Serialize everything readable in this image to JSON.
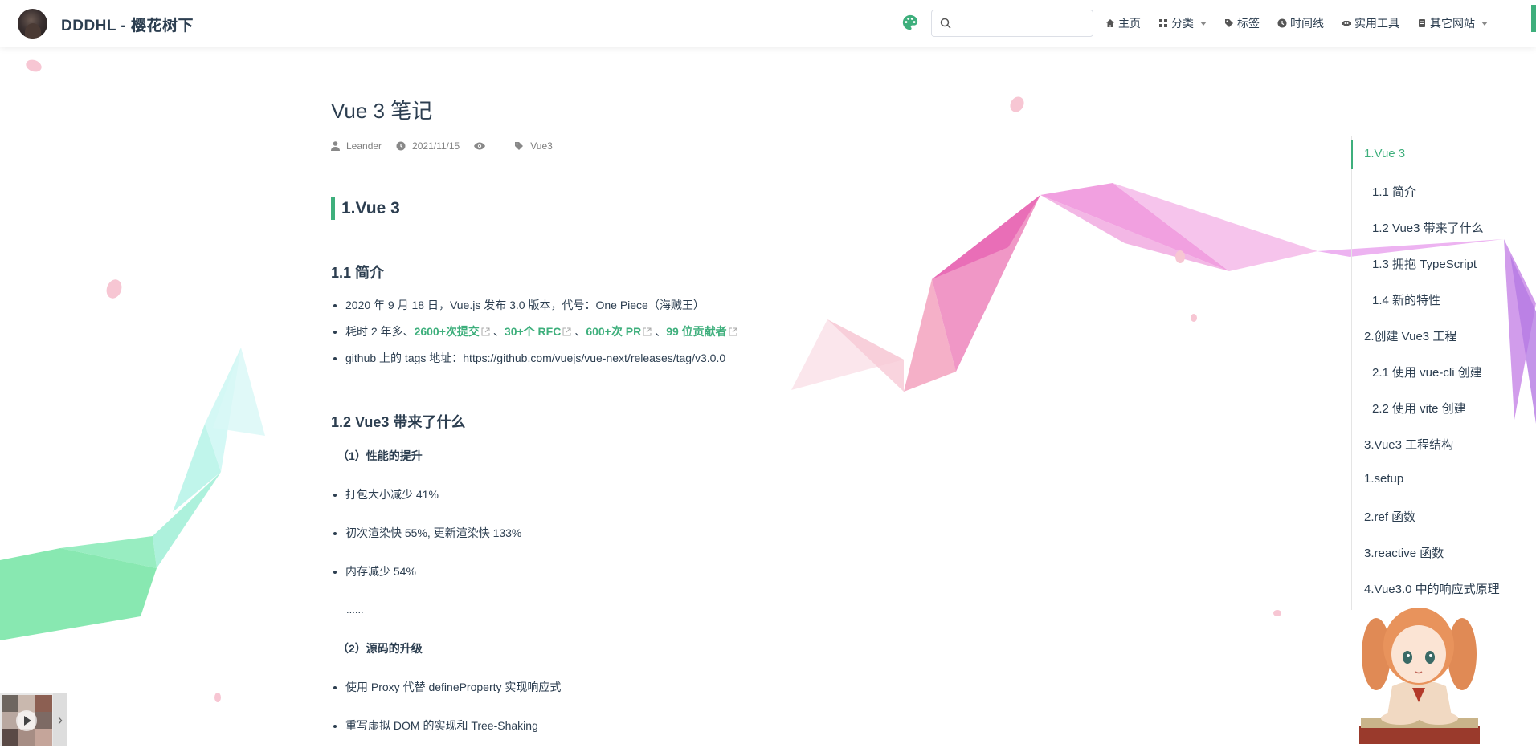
{
  "header": {
    "site_name": "DDDHL - 樱花树下",
    "search": {
      "placeholder": "",
      "value": ""
    },
    "nav": [
      {
        "label": "主页",
        "icon": "home-icon"
      },
      {
        "label": "分类",
        "icon": "grid-icon",
        "dropdown": true
      },
      {
        "label": "标签",
        "icon": "tag-icon"
      },
      {
        "label": "时间线",
        "icon": "clock-icon"
      },
      {
        "label": "实用工具",
        "icon": "robot-icon"
      },
      {
        "label": "其它网站",
        "icon": "book-icon",
        "dropdown": true
      }
    ]
  },
  "article": {
    "title": "Vue 3 笔记",
    "meta": {
      "author": "Leander",
      "date": "2021/11/15",
      "tag": "Vue3"
    },
    "h2": "1.Vue 3",
    "sec1": {
      "heading": "1.1 简介",
      "item1": "2020 年 9 月 18 日，Vue.js 发布 3.0 版本，代号：One Piece（海贼王）",
      "item2_prefix": "耗时 2 年多、",
      "links": [
        "2600+次提交",
        "30+个 RFC",
        "600+次 PR",
        "99 位贡献者"
      ],
      "sep": "、",
      "item3": "github 上的 tags 地址：https://github.com/vuejs/vue-next/releases/tag/v3.0.0"
    },
    "sec2": {
      "heading": "1.2 Vue3 带来了什么",
      "sub1": "（1）性能的提升",
      "perf": [
        "打包大小减少 41%",
        "初次渲染快 55%, 更新渲染快 133%",
        "内存减少 54%"
      ],
      "ellipsis": "......",
      "sub2": "（2）源码的升级",
      "source": [
        "使用 Proxy 代替 defineProperty 实现响应式",
        "重写虚拟 DOM 的实现和 Tree-Shaking"
      ]
    }
  },
  "toc": [
    {
      "label": "1.Vue 3",
      "level": 1,
      "active": true
    },
    {
      "label": "1.1 简介",
      "level": 2
    },
    {
      "label": "1.2 Vue3 带来了什么",
      "level": 2
    },
    {
      "label": "1.3 拥抱 TypeScript",
      "level": 2
    },
    {
      "label": "1.4 新的特性",
      "level": 2
    },
    {
      "label": "2.创建 Vue3 工程",
      "level": 1
    },
    {
      "label": "2.1 使用 vue-cli 创建",
      "level": 2
    },
    {
      "label": "2.2 使用 vite 创建",
      "level": 2
    },
    {
      "label": "3.Vue3 工程结构",
      "level": 1
    },
    {
      "label": "1.setup",
      "level": 1
    },
    {
      "label": "2.ref 函数",
      "level": 1
    },
    {
      "label": "3.reactive 函数",
      "level": 1
    },
    {
      "label": "4.Vue3.0 中的响应式原理",
      "level": 1
    }
  ],
  "colors": {
    "accent": "#3eaf7c",
    "text": "#2c3e50"
  }
}
